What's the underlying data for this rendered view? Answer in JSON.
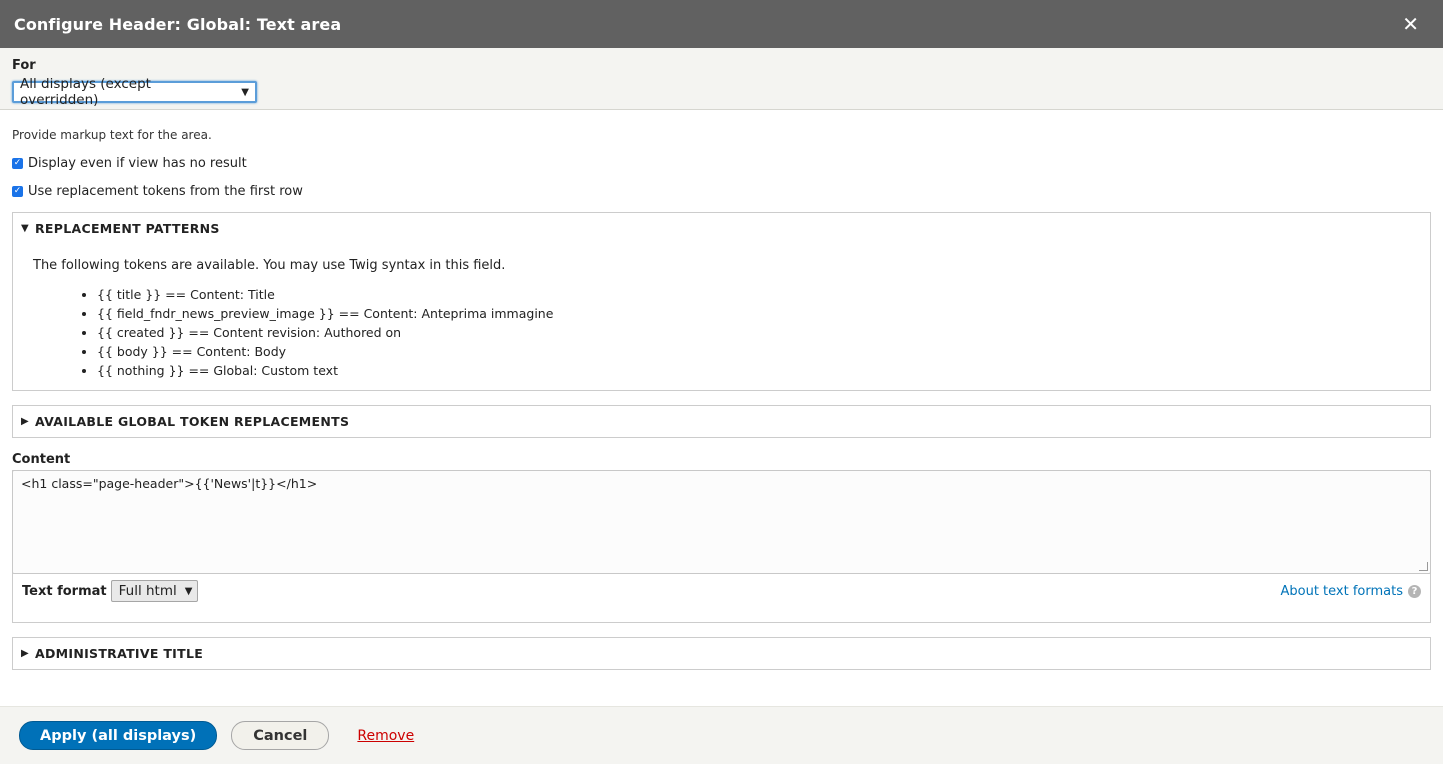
{
  "dialog": {
    "title": "Configure Header: Global: Text area",
    "close_glyph": "✕"
  },
  "for_section": {
    "label": "For",
    "selected": "All displays (except overridden)"
  },
  "description": "Provide markup text for the area.",
  "checkboxes": [
    {
      "label": "Display even if view has no result",
      "checked": true
    },
    {
      "label": "Use replacement tokens from the first row",
      "checked": true
    }
  ],
  "replacement_patterns": {
    "title": "REPLACEMENT PATTERNS",
    "expanded": true,
    "intro": "The following tokens are available. You may use Twig syntax in this field.",
    "tokens": [
      "{{ title }} == Content: Title",
      "{{ field_fndr_news_preview_image }} == Content: Anteprima immagine",
      "{{ created }} == Content revision: Authored on",
      "{{ body }} == Content: Body",
      "{{ nothing }} == Global: Custom text"
    ]
  },
  "global_tokens": {
    "title": "AVAILABLE GLOBAL TOKEN REPLACEMENTS",
    "expanded": false
  },
  "content": {
    "label": "Content",
    "value": "<h1 class=\"page-header\">{{'News'|t}}</h1>",
    "text_format_label": "Text format",
    "text_format_selected": "Full html",
    "about_link": "About text formats"
  },
  "admin_title": {
    "title": "ADMINISTRATIVE TITLE",
    "expanded": false
  },
  "footer": {
    "apply_label": "Apply (all displays)",
    "cancel_label": "Cancel",
    "remove_label": "Remove"
  },
  "colors": {
    "titlebar": "#616161",
    "primary": "#0071b8",
    "link": "#0073b8",
    "danger": "#cc0000"
  }
}
